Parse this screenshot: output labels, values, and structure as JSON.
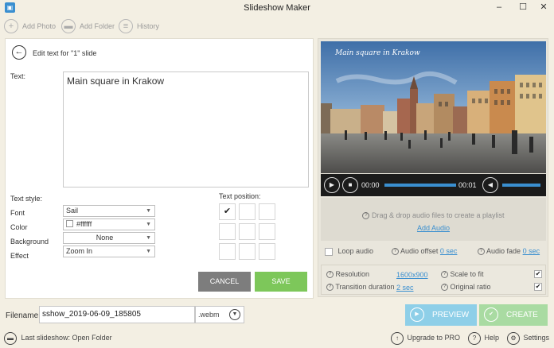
{
  "window": {
    "title": "Slideshow Maker",
    "minimize": "–",
    "maximize": "☐",
    "close": "✕"
  },
  "toolbar": {
    "add_photo": "Add Photo",
    "add_folder": "Add Folder",
    "history": "History"
  },
  "editor": {
    "heading": "Edit text for \"1\" slide",
    "text_label": "Text:",
    "text_value": "Main square in Krakow",
    "text_style_heading": "Text style:",
    "font_label": "Font",
    "font_value": "Sail",
    "color_label": "Color",
    "color_value": "#ffffff",
    "background_label": "Background",
    "background_value": "None",
    "effect_label": "Effect",
    "effect_value": "Zoom In",
    "text_position_heading": "Text position:",
    "selected_position": "top-left",
    "cancel": "CANCEL",
    "save": "SAVE"
  },
  "preview": {
    "caption": "Main square in Krakow",
    "time_current": "00:00",
    "time_total": "00:01",
    "drop_text": "Drag & drop audio files to create a playlist",
    "add_audio": "Add Audio",
    "loop_audio": "Loop audio",
    "audio_offset_label": "Audio offset",
    "audio_offset_value": "0 sec",
    "audio_fade_label": "Audio fade",
    "audio_fade_value": "0 sec"
  },
  "settings": {
    "resolution_label": "Resolution",
    "resolution_value": "1600x900",
    "transition_label": "Transition duration",
    "transition_value": "2 sec",
    "scale_label": "Scale to fit",
    "scale_checked": true,
    "ratio_label": "Original ratio",
    "ratio_checked": true
  },
  "output": {
    "filename_label": "Filename:",
    "filename_value": "sshow_2019-06-09_185805",
    "extension": ".webm",
    "preview": "PREVIEW",
    "create": "CREATE"
  },
  "status": {
    "last_slideshow": "Last slideshow: Open Folder",
    "upgrade": "Upgrade to PRO",
    "help": "Help",
    "settings": "Settings"
  }
}
